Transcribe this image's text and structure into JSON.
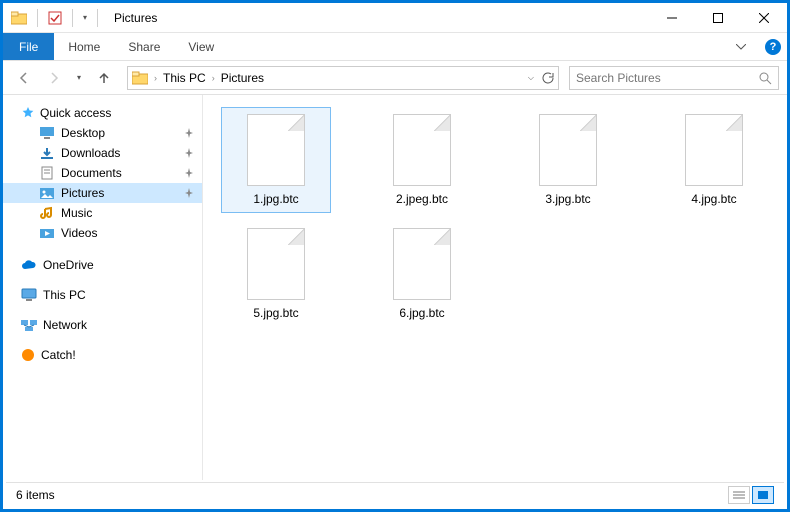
{
  "window": {
    "title": "Pictures"
  },
  "ribbon": {
    "file": "File",
    "tabs": [
      "Home",
      "Share",
      "View"
    ]
  },
  "breadcrumb": {
    "root": "This PC",
    "current": "Pictures"
  },
  "search": {
    "placeholder": "Search Pictures"
  },
  "sidebar": {
    "quick": {
      "label": "Quick access",
      "items": [
        {
          "label": "Desktop",
          "pinned": true
        },
        {
          "label": "Downloads",
          "pinned": true
        },
        {
          "label": "Documents",
          "pinned": true
        },
        {
          "label": "Pictures",
          "pinned": true,
          "selected": true
        },
        {
          "label": "Music",
          "pinned": false
        },
        {
          "label": "Videos",
          "pinned": false
        }
      ]
    },
    "onedrive": "OneDrive",
    "thispc": "This PC",
    "network": "Network",
    "catch": "Catch!"
  },
  "files": [
    {
      "name": "1.jpg.btc",
      "selected": true
    },
    {
      "name": "2.jpeg.btc"
    },
    {
      "name": "3.jpg.btc"
    },
    {
      "name": "4.jpg.btc"
    },
    {
      "name": "5.jpg.btc"
    },
    {
      "name": "6.jpg.btc"
    }
  ],
  "status": {
    "count": "6 items"
  }
}
